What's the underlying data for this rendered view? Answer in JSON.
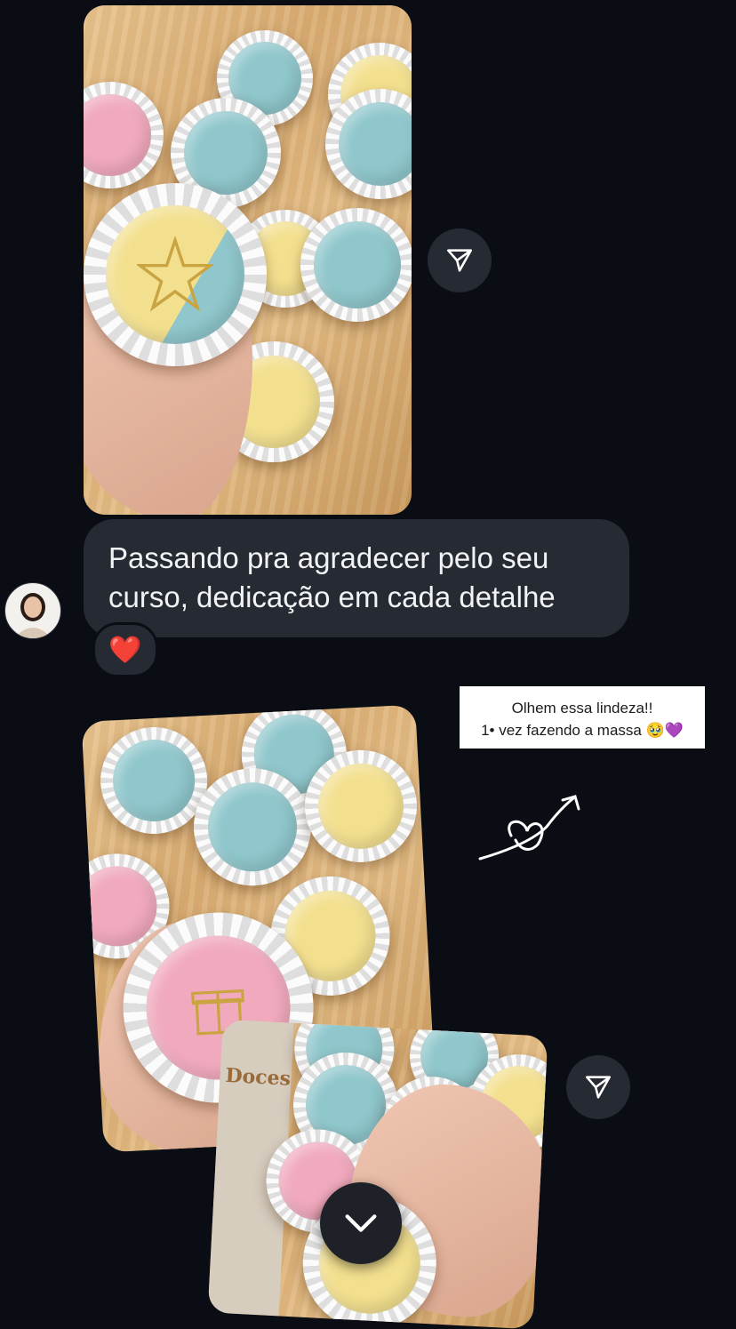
{
  "message": {
    "text": "Passando pra agradecer pelo seu curso, dedicação em cada detalhe",
    "reaction": "❤️"
  },
  "note": {
    "line1": "Olhem essa lindeza!!",
    "line2": "1• vez fazendo a massa 🥹💜"
  },
  "photo3": {
    "brand": "Doces"
  },
  "icons": {
    "send": "send-icon",
    "scroll_down": "chevron-down-icon",
    "doodle": "heart-arrow-doodle"
  },
  "colors": {
    "background": "#0b0d14",
    "bubble": "#262a33",
    "text": "#f2f3f5"
  }
}
